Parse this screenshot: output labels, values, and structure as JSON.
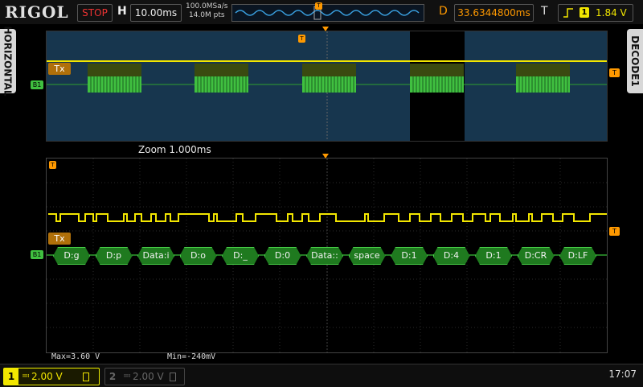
{
  "topbar": {
    "brand": "RIGOL",
    "run_state": "STOP",
    "timebase_label": "H",
    "timebase_value": "10.00ms",
    "sample_rate": "100.0MSa/s",
    "memory_depth": "14.0M pts",
    "delay_label": "D",
    "delay_value": "33.6344800ms",
    "trigger_label": "T",
    "trigger_channel": "1",
    "trigger_level": "1.84 V"
  },
  "left_tab": "HORIZONTAL",
  "right_tab": "DECODE1",
  "overview": {
    "bus_label": "Tx",
    "channel_marker": "B1"
  },
  "zoom_label": "Zoom 1.000ms",
  "decode": {
    "bus_label": "Tx",
    "channel_marker": "B1",
    "frames": [
      "D:g",
      "D:p",
      "Data:i",
      "D:o",
      "D:_",
      "D:0",
      "Data::",
      "space",
      "D:1",
      "D:4",
      "D:1",
      "D:CR",
      "D:LF"
    ]
  },
  "measurements": {
    "max": "Max=3.60 V",
    "min": "Min=-240mV"
  },
  "bottombar": {
    "ch1_number": "1",
    "ch1_scale": "2.00 V",
    "ch2_number": "2",
    "ch2_scale": "2.00 V",
    "clock": "17:07"
  },
  "colors": {
    "ch1": "#f2e600",
    "bus": "#2fa02f",
    "bus_label": "#b0700a",
    "trigger": "#ff9900",
    "overview_bg": "#17364e"
  }
}
